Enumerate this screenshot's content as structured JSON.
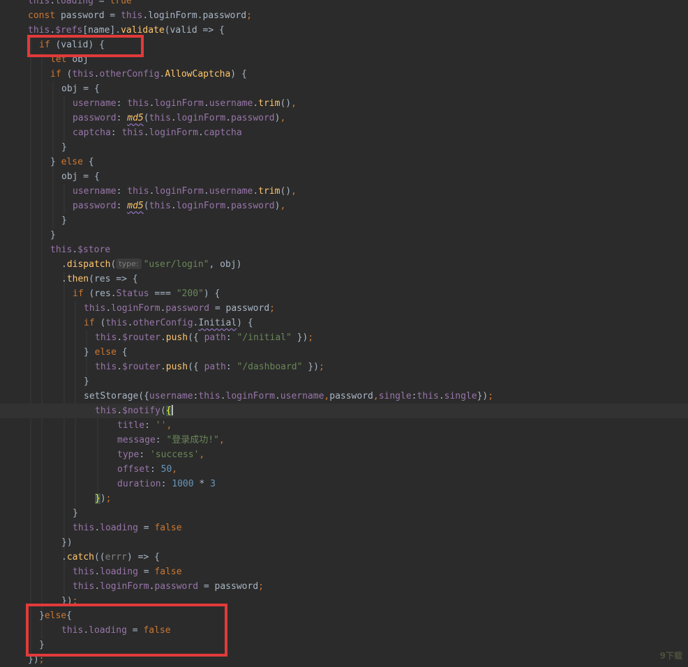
{
  "editor": {
    "lines": [
      [
        [
          "vr",
          "this"
        ],
        [
          "pl",
          "."
        ],
        [
          "vr",
          "loading"
        ],
        [
          "pl",
          " = "
        ],
        [
          "kw",
          "true"
        ]
      ],
      [
        [
          "kw",
          "const "
        ],
        [
          "pl",
          "password = "
        ],
        [
          "vr",
          "this"
        ],
        [
          "pl",
          ".loginForm.password"
        ],
        [
          "kw",
          ";"
        ]
      ],
      [
        [
          "vr",
          "this"
        ],
        [
          "pl",
          "."
        ],
        [
          "vr",
          "$refs"
        ],
        [
          "pl",
          "[name]."
        ],
        [
          "fn",
          "validate"
        ],
        [
          "pl",
          "(valid => {"
        ]
      ],
      [
        [
          "kw",
          "if "
        ],
        [
          "pl",
          "(valid) {"
        ]
      ],
      [
        [
          "kw",
          "let "
        ],
        [
          "pl",
          "obj"
        ]
      ],
      [
        [
          "kw",
          "if "
        ],
        [
          "pl",
          "("
        ],
        [
          "vr",
          "this"
        ],
        [
          "pl",
          "."
        ],
        [
          "vr",
          "otherConfig"
        ],
        [
          "pl",
          "."
        ],
        [
          "fn",
          "AllowCaptcha"
        ],
        [
          "pl",
          ") {"
        ]
      ],
      [
        [
          "pl",
          "obj = {"
        ]
      ],
      [
        [
          "vr",
          "username"
        ],
        [
          "pl",
          ": "
        ],
        [
          "vr",
          "this"
        ],
        [
          "pl",
          "."
        ],
        [
          "vr",
          "loginForm"
        ],
        [
          "pl",
          "."
        ],
        [
          "vr",
          "username"
        ],
        [
          "pl",
          "."
        ],
        [
          "fn",
          "trim"
        ],
        [
          "pl",
          "()"
        ],
        [
          "kw",
          ","
        ]
      ],
      [
        [
          "vr",
          "password"
        ],
        [
          "pl",
          ": "
        ],
        [
          "itf",
          "md5"
        ],
        [
          "pl",
          "("
        ],
        [
          "vr",
          "this"
        ],
        [
          "pl",
          "."
        ],
        [
          "vr",
          "loginForm"
        ],
        [
          "pl",
          "."
        ],
        [
          "vr",
          "password"
        ],
        [
          "pl",
          ")"
        ],
        [
          "kw",
          ","
        ]
      ],
      [
        [
          "vr",
          "captcha"
        ],
        [
          "pl",
          ": "
        ],
        [
          "vr",
          "this"
        ],
        [
          "pl",
          "."
        ],
        [
          "vr",
          "loginForm"
        ],
        [
          "pl",
          "."
        ],
        [
          "vr",
          "captcha"
        ]
      ],
      [
        [
          "pl",
          "}"
        ]
      ],
      [
        [
          "pl",
          "} "
        ],
        [
          "kw",
          "else "
        ],
        [
          "pl",
          "{"
        ]
      ],
      [
        [
          "pl",
          "obj = {"
        ]
      ],
      [
        [
          "vr",
          "username"
        ],
        [
          "pl",
          ": "
        ],
        [
          "vr",
          "this"
        ],
        [
          "pl",
          "."
        ],
        [
          "vr",
          "loginForm"
        ],
        [
          "pl",
          "."
        ],
        [
          "vr",
          "username"
        ],
        [
          "pl",
          "."
        ],
        [
          "fn",
          "trim"
        ],
        [
          "pl",
          "()"
        ],
        [
          "kw",
          ","
        ]
      ],
      [
        [
          "vr",
          "password"
        ],
        [
          "pl",
          ": "
        ],
        [
          "itf",
          "md5"
        ],
        [
          "pl",
          "("
        ],
        [
          "vr",
          "this"
        ],
        [
          "pl",
          "."
        ],
        [
          "vr",
          "loginForm"
        ],
        [
          "pl",
          "."
        ],
        [
          "vr",
          "password"
        ],
        [
          "pl",
          ")"
        ],
        [
          "kw",
          ","
        ]
      ],
      [
        [
          "pl",
          "}"
        ]
      ],
      [
        [
          "pl",
          "}"
        ]
      ],
      [
        [
          "vr",
          "this"
        ],
        [
          "pl",
          "."
        ],
        [
          "vr",
          "$store"
        ]
      ],
      [
        [
          "pl",
          "."
        ],
        [
          "fn",
          "dispatch"
        ],
        [
          "pl",
          "("
        ],
        [
          "hint",
          "type:"
        ],
        [
          "st",
          "\"user/login\""
        ],
        [
          "pl",
          ", obj)"
        ]
      ],
      [
        [
          "pl",
          "."
        ],
        [
          "fn",
          "then"
        ],
        [
          "pl",
          "(res => {"
        ]
      ],
      [
        [
          "kw",
          "if "
        ],
        [
          "pl",
          "(res."
        ],
        [
          "vr",
          "Status"
        ],
        [
          "pl",
          " === "
        ],
        [
          "st",
          "\"200\""
        ],
        [
          "pl",
          ") {"
        ]
      ],
      [
        [
          "vr",
          "this"
        ],
        [
          "pl",
          "."
        ],
        [
          "vr",
          "loginForm"
        ],
        [
          "pl",
          "."
        ],
        [
          "vr",
          "password"
        ],
        [
          "pl",
          " = password"
        ],
        [
          "kw",
          ";"
        ]
      ],
      [
        [
          "kw",
          "if "
        ],
        [
          "pl",
          "("
        ],
        [
          "vr",
          "this"
        ],
        [
          "pl",
          "."
        ],
        [
          "vr",
          "otherConfig"
        ],
        [
          "pl",
          "."
        ],
        [
          "wv",
          "Initial"
        ],
        [
          "pl",
          ") {"
        ]
      ],
      [
        [
          "vr",
          "this"
        ],
        [
          "pl",
          "."
        ],
        [
          "vr",
          "$router"
        ],
        [
          "pl",
          "."
        ],
        [
          "fn",
          "push"
        ],
        [
          "pl",
          "({ "
        ],
        [
          "vr",
          "path"
        ],
        [
          "pl",
          ": "
        ],
        [
          "st",
          "\"/initial\""
        ],
        [
          "pl",
          " })"
        ],
        [
          "kw",
          ";"
        ]
      ],
      [
        [
          "pl",
          "} "
        ],
        [
          "kw",
          "else "
        ],
        [
          "pl",
          "{"
        ]
      ],
      [
        [
          "vr",
          "this"
        ],
        [
          "pl",
          "."
        ],
        [
          "vr",
          "$router"
        ],
        [
          "pl",
          "."
        ],
        [
          "fn",
          "push"
        ],
        [
          "pl",
          "({ "
        ],
        [
          "vr",
          "path"
        ],
        [
          "pl",
          ": "
        ],
        [
          "st",
          "\"/dashboard\""
        ],
        [
          "pl",
          " })"
        ],
        [
          "kw",
          ";"
        ]
      ],
      [
        [
          "pl",
          "}"
        ]
      ],
      [
        [
          "pl",
          "setStorage({"
        ],
        [
          "vr",
          "username"
        ],
        [
          "pl",
          ":"
        ],
        [
          "vr",
          "this"
        ],
        [
          "pl",
          "."
        ],
        [
          "vr",
          "loginForm"
        ],
        [
          "pl",
          "."
        ],
        [
          "vr",
          "username"
        ],
        [
          "kw",
          ","
        ],
        [
          "pl",
          "password"
        ],
        [
          "kw",
          ","
        ],
        [
          "vr",
          "single"
        ],
        [
          "pl",
          ":"
        ],
        [
          "vr",
          "this"
        ],
        [
          "pl",
          "."
        ],
        [
          "vr",
          "single"
        ],
        [
          "pl",
          "})"
        ],
        [
          "kw",
          ";"
        ]
      ],
      [
        [
          "vr",
          "this"
        ],
        [
          "pl",
          "."
        ],
        [
          "vr",
          "$notify"
        ],
        [
          "pl",
          "("
        ],
        [
          "bh",
          "{"
        ],
        [
          "cursor",
          ""
        ]
      ],
      [
        [
          "vr",
          "title"
        ],
        [
          "pl",
          ": "
        ],
        [
          "st",
          "''"
        ],
        [
          "kw",
          ","
        ]
      ],
      [
        [
          "vr",
          "message"
        ],
        [
          "pl",
          ": "
        ],
        [
          "st",
          "\"登录成功!\""
        ],
        [
          "kw",
          ","
        ]
      ],
      [
        [
          "vr",
          "type"
        ],
        [
          "pl",
          ": "
        ],
        [
          "st",
          "'success'"
        ],
        [
          "kw",
          ","
        ]
      ],
      [
        [
          "vr",
          "offset"
        ],
        [
          "pl",
          ": "
        ],
        [
          "nm",
          "50"
        ],
        [
          "kw",
          ","
        ]
      ],
      [
        [
          "vr",
          "duration"
        ],
        [
          "pl",
          ": "
        ],
        [
          "nm",
          "1000"
        ],
        [
          "pl",
          " * "
        ],
        [
          "nm",
          "3"
        ]
      ],
      [
        [
          "bh",
          "}"
        ],
        [
          "pl",
          ")"
        ],
        [
          "kw",
          ";"
        ]
      ],
      [
        [
          "pl",
          "}"
        ]
      ],
      [
        [
          "vr",
          "this"
        ],
        [
          "pl",
          "."
        ],
        [
          "vr",
          "loading"
        ],
        [
          "pl",
          " = "
        ],
        [
          "kw",
          "false"
        ]
      ],
      [
        [
          "pl",
          "})"
        ]
      ],
      [
        [
          "pl",
          "."
        ],
        [
          "fn",
          "catch"
        ],
        [
          "pl",
          "(("
        ],
        [
          "dim",
          "errr"
        ],
        [
          "pl",
          ") => {"
        ]
      ],
      [
        [
          "vr",
          "this"
        ],
        [
          "pl",
          "."
        ],
        [
          "vr",
          "loading"
        ],
        [
          "pl",
          " = "
        ],
        [
          "kw",
          "false"
        ]
      ],
      [
        [
          "vr",
          "this"
        ],
        [
          "pl",
          "."
        ],
        [
          "vr",
          "loginForm"
        ],
        [
          "pl",
          "."
        ],
        [
          "vr",
          "password"
        ],
        [
          "pl",
          " = password"
        ],
        [
          "kw",
          ";"
        ]
      ],
      [
        [
          "pl",
          "})"
        ],
        [
          "kw",
          ";"
        ]
      ],
      [
        [
          "pl",
          "}"
        ],
        [
          "kw",
          "else"
        ],
        [
          "pl",
          "{"
        ]
      ],
      [
        [
          "vr",
          "this"
        ],
        [
          "pl",
          "."
        ],
        [
          "vr",
          "loading"
        ],
        [
          "pl",
          " = "
        ],
        [
          "kw",
          "false"
        ]
      ],
      [
        [
          "pl",
          "}"
        ]
      ],
      [
        [
          "pl",
          "})"
        ],
        [
          "kw",
          ";"
        ]
      ]
    ]
  },
  "colors": {
    "background": "#2b2b2b",
    "highlight_box": "#e23a3a",
    "keyword": "#cc7832",
    "field": "#9876aa",
    "function": "#ffc66d",
    "string": "#6a8759",
    "number": "#6897bb",
    "plain": "#a9b7c6"
  },
  "watermark": {
    "text": "9下载"
  }
}
